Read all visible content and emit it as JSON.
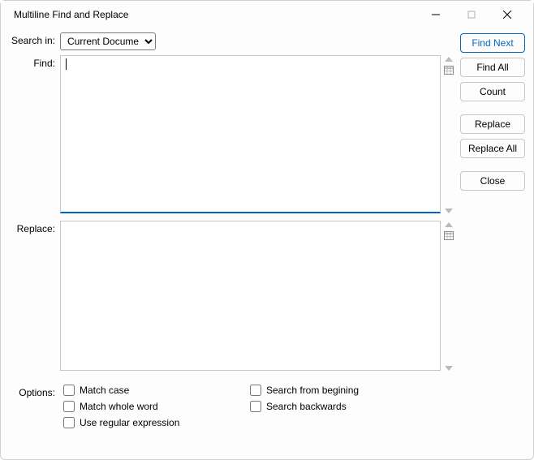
{
  "window": {
    "title": "Multiline Find and Replace"
  },
  "labels": {
    "search_in": "Search in:",
    "find": "Find:",
    "replace": "Replace:",
    "options": "Options:"
  },
  "search_in": {
    "selected": "Current Document",
    "options": [
      "Current Document"
    ]
  },
  "find": {
    "value": ""
  },
  "replace": {
    "value": ""
  },
  "buttons": {
    "find_next": "Find Next",
    "find_all": "Find All",
    "count": "Count",
    "replace": "Replace",
    "replace_all": "Replace All",
    "close": "Close"
  },
  "options": {
    "match_case": "Match case",
    "match_whole_word": "Match whole word",
    "use_regex": "Use regular expression",
    "search_from_beginning": "Search from begining",
    "search_backwards": "Search backwards"
  }
}
